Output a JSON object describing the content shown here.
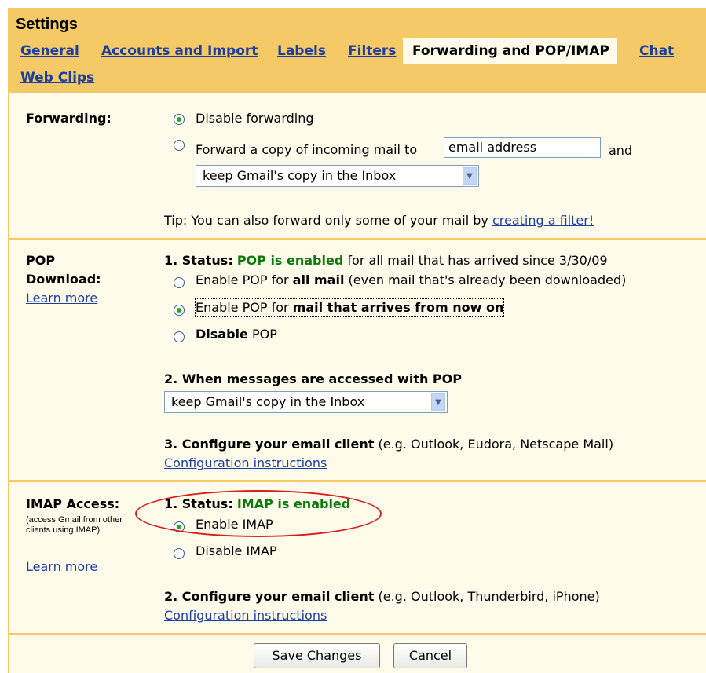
{
  "title": "Settings",
  "tabs": {
    "general": "General",
    "accounts": "Accounts and Import",
    "labels": "Labels",
    "filters": "Filters",
    "forwarding": "Forwarding and POP/IMAP",
    "chat": "Chat",
    "webclips": "Web Clips"
  },
  "forwarding": {
    "label": "Forwarding:",
    "disable": "Disable forwarding",
    "forward_prefix": "Forward a copy of incoming mail to",
    "email_value": "email address",
    "and": "and",
    "keep_option": "keep Gmail's copy in the Inbox",
    "tip_prefix": "Tip: You can also forward only some of your mail by ",
    "tip_link": "creating a filter!"
  },
  "pop": {
    "label_line1": "POP",
    "label_line2": "Download:",
    "learn_more": "Learn more",
    "status_prefix": "1. Status:",
    "status_value": "POP is enabled",
    "status_suffix": "for all mail that has arrived since 3/30/09",
    "opt_all_prefix": "Enable POP for ",
    "opt_all_bold": "all mail",
    "opt_all_suffix": " (even mail that's already been downloaded)",
    "opt_now_prefix": "Enable POP for ",
    "opt_now_bold": "mail that arrives from now on",
    "opt_disable_bold": "Disable",
    "opt_disable_suffix": " POP",
    "when_heading": "2. When messages are accessed with POP",
    "when_option": "keep Gmail's copy in the Inbox",
    "configure_bold": "3. Configure your email client",
    "configure_suffix": " (e.g. Outlook, Eudora, Netscape Mail)",
    "config_link": "Configuration instructions"
  },
  "imap": {
    "label": "IMAP Access:",
    "note": "(access Gmail from other clients using IMAP)",
    "learn_more": "Learn more",
    "status_prefix": "1. Status:",
    "status_value": "IMAP is enabled",
    "enable": "Enable IMAP",
    "disable": "Disable IMAP",
    "configure_bold": "2. Configure your email client",
    "configure_suffix": " (e.g. Outlook, Thunderbird, iPhone)",
    "config_link": "Configuration instructions"
  },
  "buttons": {
    "save": "Save Changes",
    "cancel": "Cancel"
  },
  "colors": {
    "header": "#f5c965",
    "panel": "#fffbea",
    "link": "#1a3ea1",
    "status_green": "#0a7a0a",
    "annotation": "#d62020"
  }
}
